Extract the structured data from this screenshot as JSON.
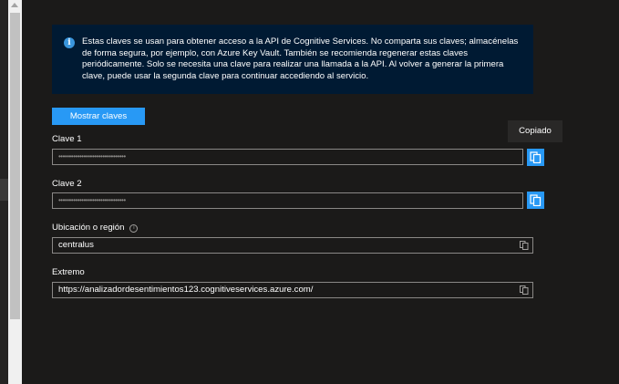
{
  "info": {
    "icon": "info-icon",
    "text": "Estas claves se usan para obtener acceso a la API de Cognitive Services. No comparta sus claves; almacénelas de forma segura, por ejemplo, con Azure Key Vault. También se recomienda regenerar estas claves periódicamente. Solo se necesita una clave para realizar una llamada a la API. Al volver a generar la primera clave, puede usar la segunda clave para continuar accediendo al servicio."
  },
  "buttons": {
    "show_keys": "Mostrar claves"
  },
  "tooltip": {
    "text": "Copiado"
  },
  "fields": {
    "key1": {
      "label": "Clave 1",
      "value": "••••••••••••••••••••••••••••••••"
    },
    "key2": {
      "label": "Clave 2",
      "value": "••••••••••••••••••••••••••••••••"
    },
    "region": {
      "label": "Ubicación o región",
      "value": "centralus"
    },
    "endpoint": {
      "label": "Extremo",
      "value": "https://analizadordesentimientos123.cognitiveservices.azure.com/"
    }
  },
  "colors": {
    "background": "#1b1a19",
    "info_background": "#001a33",
    "accent": "#2899f5",
    "field_border": "#8a8886"
  }
}
